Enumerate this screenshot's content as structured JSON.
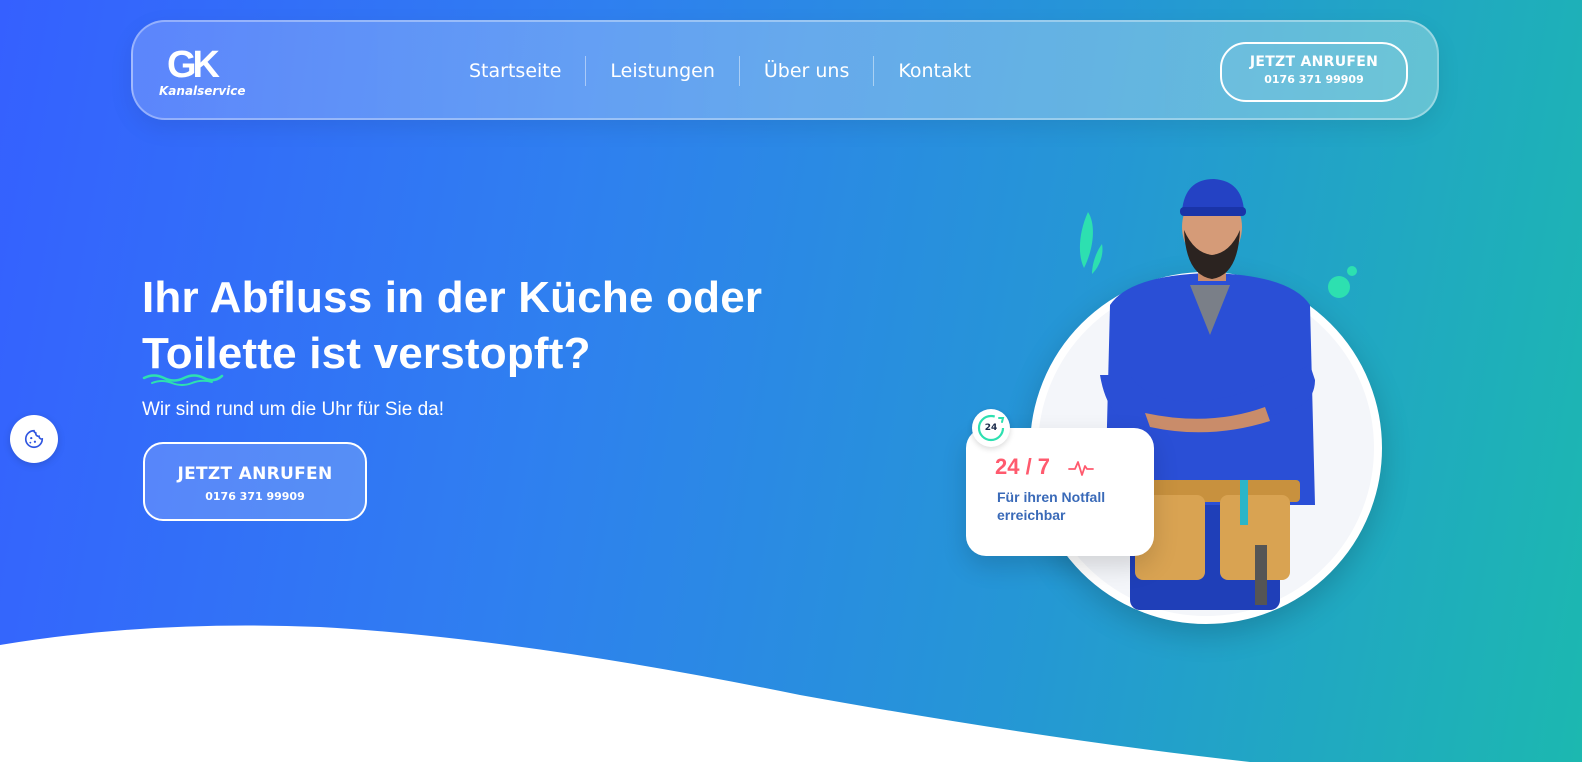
{
  "brand": {
    "logo_mark": "GK",
    "logo_sub": "Kanalservice"
  },
  "nav": {
    "links": [
      "Startseite",
      "Leistungen",
      "Über uns",
      "Kontakt"
    ],
    "cta": {
      "label": "JETZT ANRUFEN",
      "phone": "0176 371 99909"
    }
  },
  "hero": {
    "title": "Ihr Abfluss in der Küche oder Toilette ist verstopft?",
    "subtitle": "Wir sind rund um die Uhr für Sie da!",
    "cta": {
      "label": "JETZT ANRUFEN",
      "phone": "0176 371 99909"
    }
  },
  "badge": {
    "title": "24 / 7",
    "text": "Für ihren Notfall erreichbar",
    "clock_label": "24"
  },
  "icons": {
    "cookie": "cookie-icon",
    "pulse": "heartbeat-icon",
    "clock": "clock-24-icon"
  },
  "colors": {
    "accent": "#2de0b0",
    "badge_red": "#ff5a6e",
    "badge_text": "#3a6ab8",
    "gradient_start": "#3560ff",
    "gradient_end": "#1cb8b0"
  }
}
